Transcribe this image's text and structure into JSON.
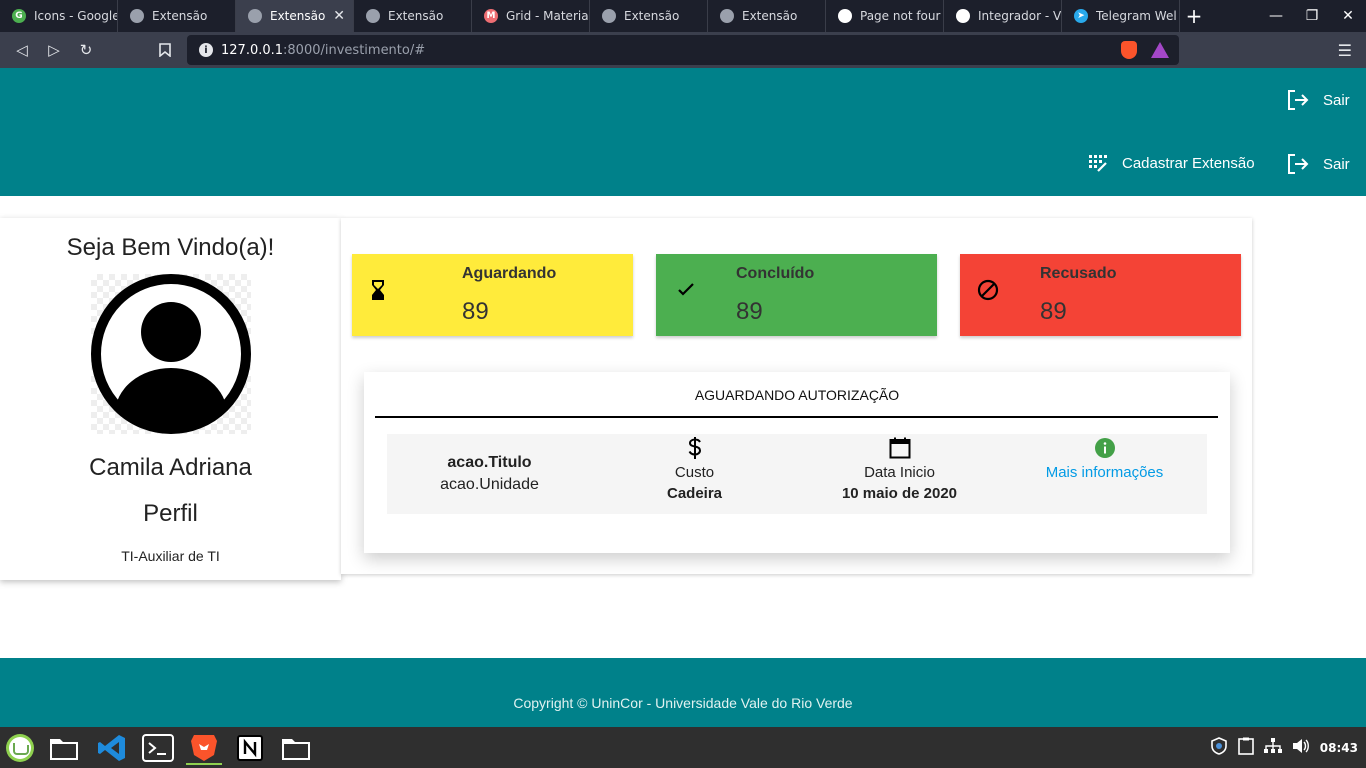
{
  "browser": {
    "tabs": [
      {
        "label": "Icons - Google",
        "favicon_color": "#4caf50",
        "active": false
      },
      {
        "label": "Extensão",
        "favicon_color": "#9aa0ac",
        "active": false
      },
      {
        "label": "Extensão",
        "favicon_color": "#9aa0ac",
        "active": true
      },
      {
        "label": "Extensão",
        "favicon_color": "#9aa0ac",
        "active": false
      },
      {
        "label": "Grid - Materia",
        "favicon_color": "#ee6e73",
        "active": false
      },
      {
        "label": "Extensão",
        "favicon_color": "#9aa0ac",
        "active": false
      },
      {
        "label": "Extensão",
        "favicon_color": "#9aa0ac",
        "active": false
      },
      {
        "label": "Page not four",
        "favicon_color": "#ffffff",
        "active": false
      },
      {
        "label": "Integrador - V",
        "favicon_color": "#ffffff",
        "active": false
      },
      {
        "label": "Telegram Wel",
        "favicon_color": "#29a9eb",
        "active": false
      }
    ],
    "new_tab": "+",
    "url_host": "127.0.0.1",
    "url_rest": ":8000/investimento/#"
  },
  "header": {
    "top_logout": "Sair",
    "register_extension": "Cadastrar Extensão",
    "logout": "Sair",
    "bg_color": "#00818a"
  },
  "profile": {
    "welcome": "Seja Bem Vindo(a)!",
    "name": "Camila Adriana",
    "role": "Perfil",
    "department": "TI-Auxiliar de TI"
  },
  "stats": [
    {
      "label": "Aguardando",
      "value": "89",
      "icon": "hourglass-icon",
      "color": "#ffeb3b"
    },
    {
      "label": "Concluído",
      "value": "89",
      "icon": "check-icon",
      "color": "#4caf50"
    },
    {
      "label": "Recusado",
      "value": "89",
      "icon": "block-icon",
      "color": "#f44336"
    }
  ],
  "authorization": {
    "title": "AGUARDANDO AUTORIZAÇÃO",
    "action_title": "acao.Titulo",
    "action_unit": "acao.Unidade",
    "cost_label": "Custo",
    "cost_value": "Cadeira",
    "date_label": "Data Inicio",
    "date_value": "10 maio de 2020",
    "more_info": "Mais informações"
  },
  "footer": {
    "copyright": "Copyright © UninCor - Universidade Vale do Rio Verde"
  },
  "taskbar": {
    "clock": "08:43"
  }
}
